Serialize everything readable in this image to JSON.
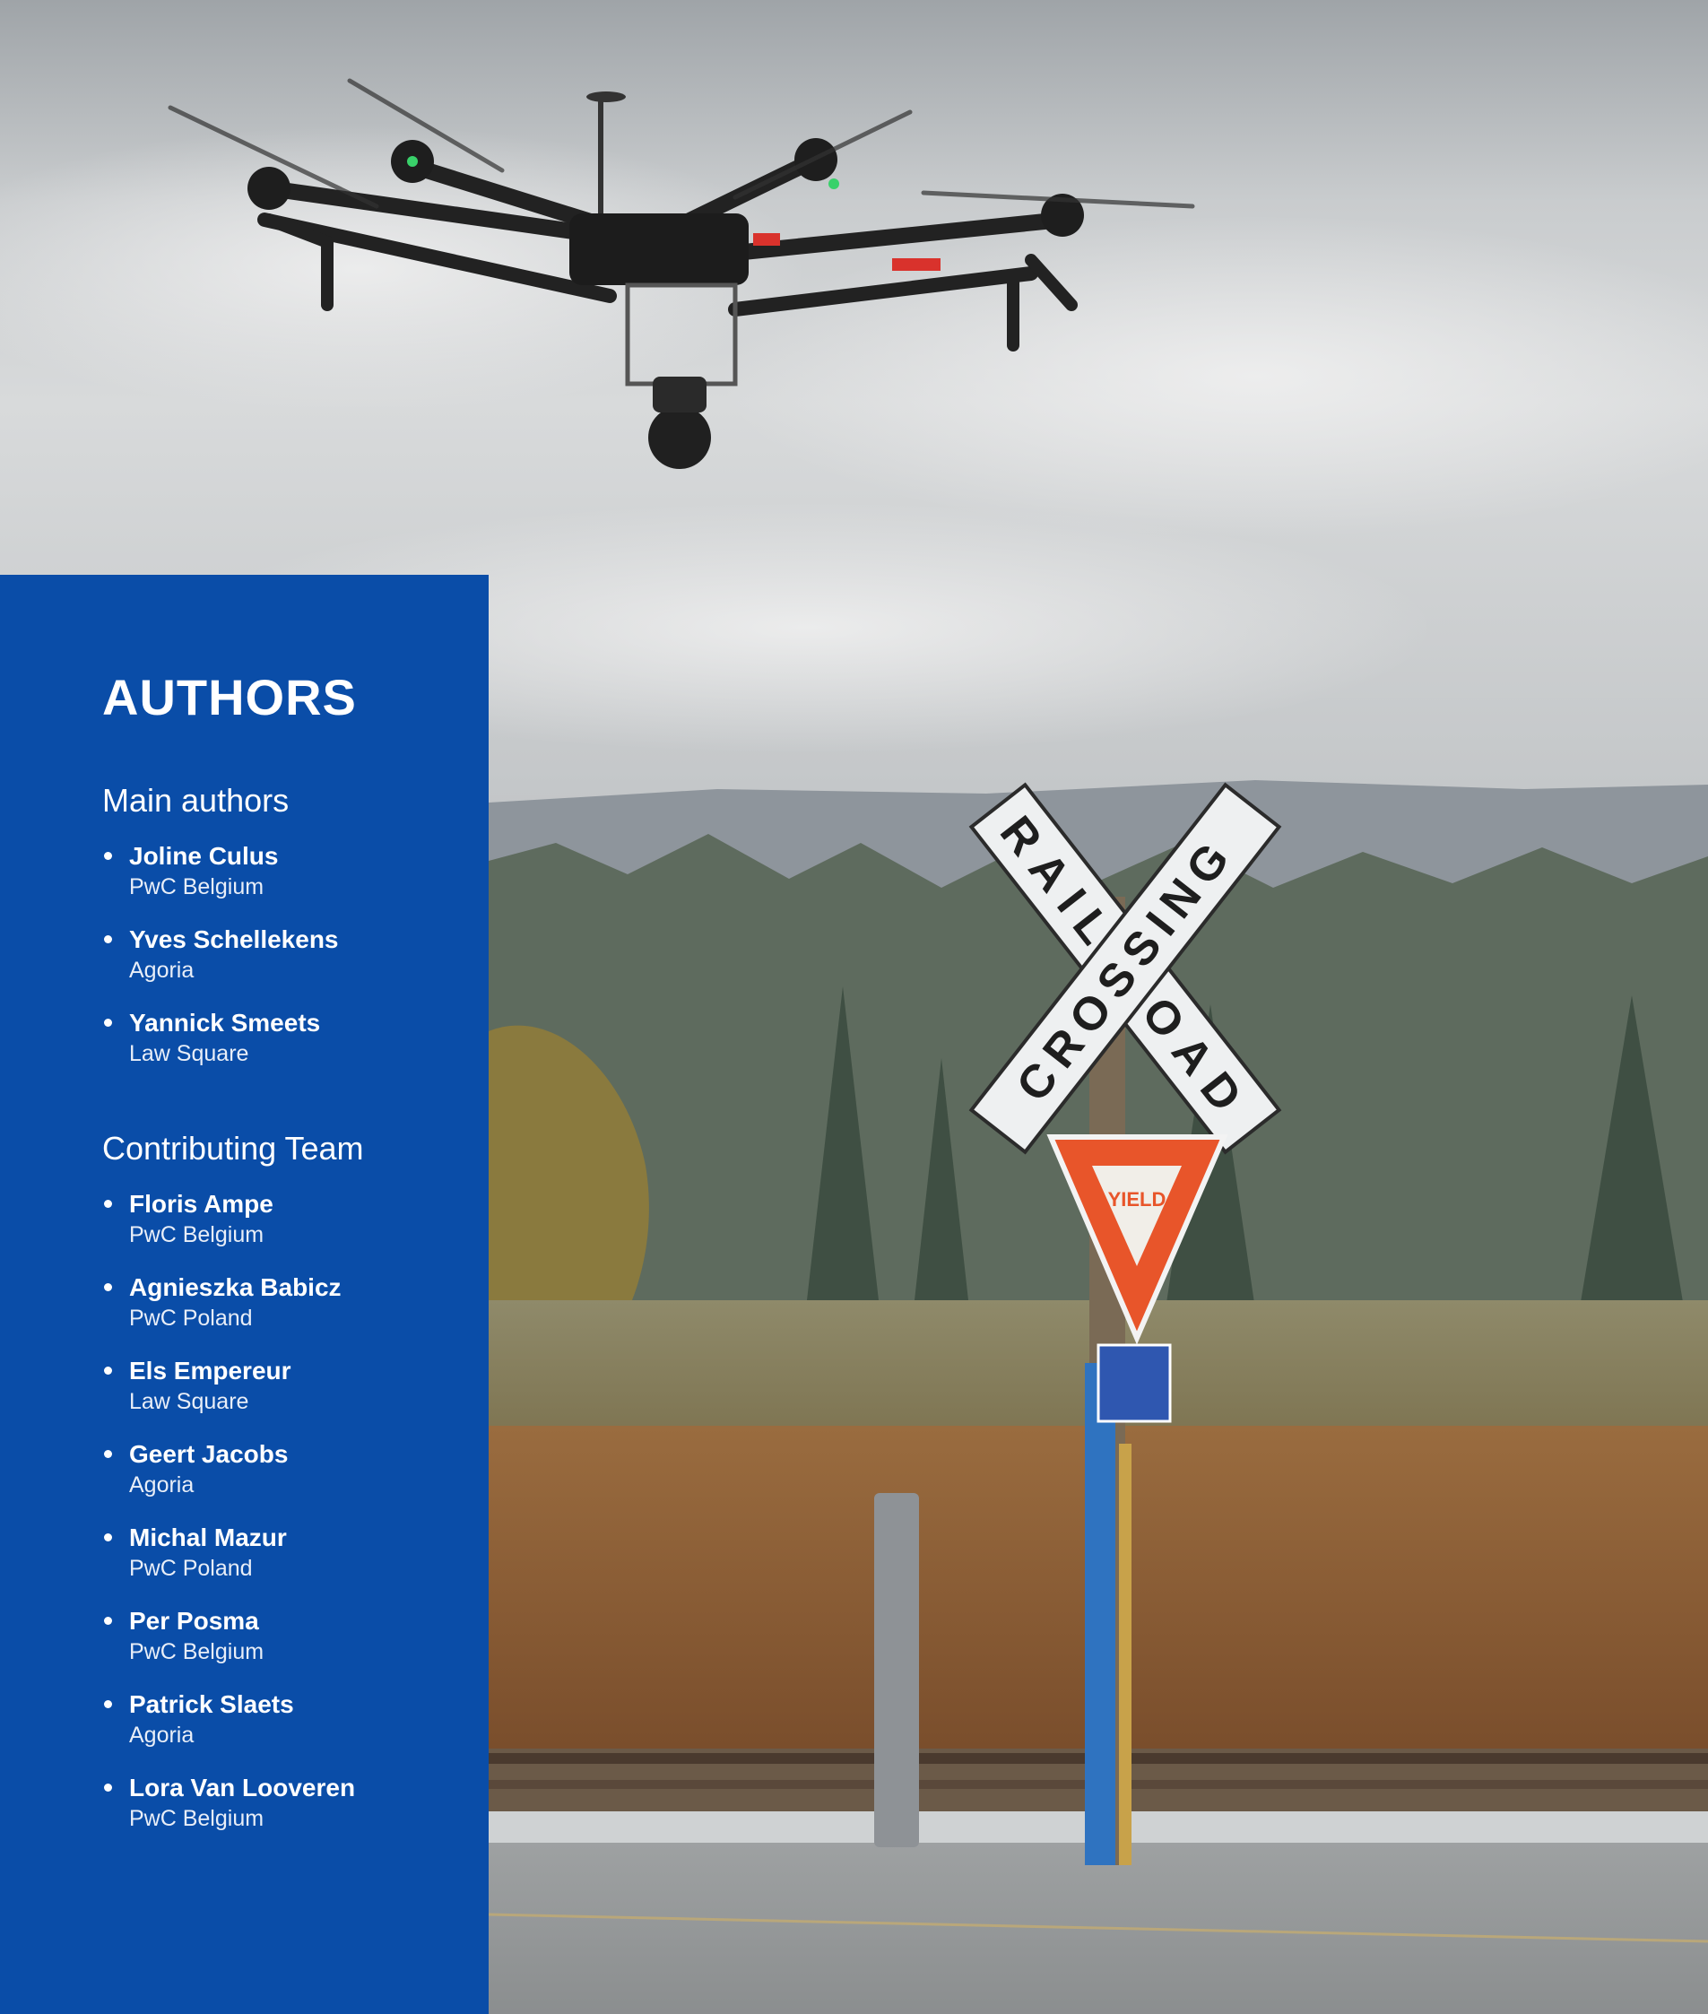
{
  "sidebar": {
    "heading": "AUTHORS",
    "main_authors_title": "Main authors",
    "main_authors": [
      {
        "name": "Joline Culus",
        "org": "PwC Belgium"
      },
      {
        "name": "Yves Schellekens",
        "org": "Agoria"
      },
      {
        "name": "Yannick Smeets",
        "org": "Law Square"
      }
    ],
    "contributing_title": "Contributing Team",
    "contributing": [
      {
        "name": "Floris Ampe",
        "org": "PwC Belgium"
      },
      {
        "name": "Agnieszka Babicz",
        "org": "PwC Poland"
      },
      {
        "name": "Els Empereur",
        "org": "Law Square"
      },
      {
        "name": "Geert Jacobs",
        "org": "Agoria"
      },
      {
        "name": "Michal Mazur",
        "org": "PwC Poland"
      },
      {
        "name": "Per Posma",
        "org": "PwC Belgium"
      },
      {
        "name": "Patrick Slaets",
        "org": "Agoria"
      },
      {
        "name": "Lora Van Looveren",
        "org": "PwC Belgium"
      }
    ]
  },
  "photo": {
    "sign_top_text": "RAIL ROAD",
    "sign_cross_text": "CROSSING",
    "yield_text": "YIELD"
  },
  "colors": {
    "panel": "#0a4da8",
    "text": "#ffffff"
  }
}
